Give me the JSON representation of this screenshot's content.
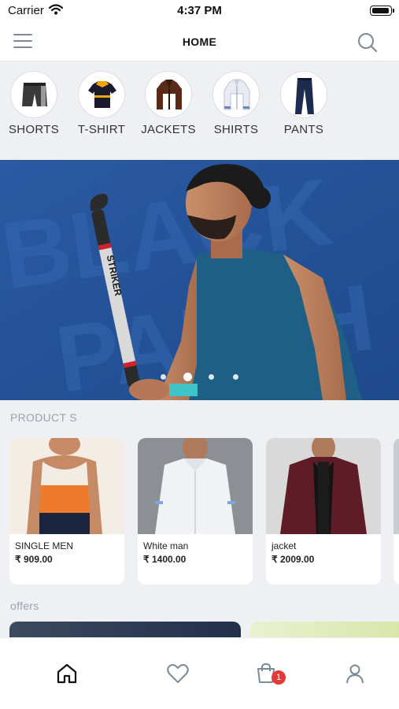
{
  "status_bar": {
    "carrier": "Carrier",
    "time": "4:37 PM"
  },
  "header": {
    "title": "HOME"
  },
  "categories": [
    {
      "label": "SHORTS",
      "icon": "shorts-icon"
    },
    {
      "label": "T-SHIRT",
      "icon": "tshirt-icon"
    },
    {
      "label": "JACKETS",
      "icon": "jacket-icon"
    },
    {
      "label": "SHIRTS",
      "icon": "shirt-icon"
    },
    {
      "label": "PANTS",
      "icon": "pants-icon"
    }
  ],
  "banner": {
    "dot_count": 4,
    "active_dot": 2,
    "stick_text": "STRIKER",
    "background_text": "BLACK PANTHER"
  },
  "products_section": {
    "title": "PRODUCT S"
  },
  "products": [
    {
      "name": "SINGLE MEN",
      "price": "₹ 909.00"
    },
    {
      "name": "White man",
      "price": "₹ 1400.00"
    },
    {
      "name": "jacket",
      "price": "₹ 2009.00"
    }
  ],
  "offers_section": {
    "title": "offers"
  },
  "tab_bar": {
    "tabs": [
      "home-icon",
      "heart-icon",
      "cart-icon",
      "profile-icon"
    ],
    "cart_badge": "1"
  },
  "colors": {
    "accent": "#26549a",
    "badge": "#e53935",
    "muted_text": "#9aa2ad"
  }
}
